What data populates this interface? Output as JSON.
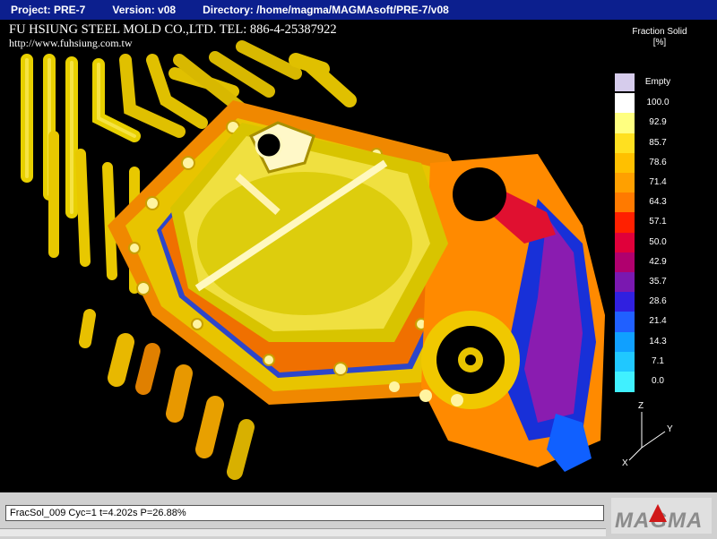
{
  "titlebar": {
    "project": "Project: PRE-7",
    "version": "Version: v08",
    "directory": "Directory: /home/magma/MAGMAsoft/PRE-7/v08"
  },
  "overlay": {
    "company_line": "FU HSIUNG STEEL MOLD CO.,LTD.  TEL:  886-4-25387922",
    "url": "http://www.fuhsiung.com.tw"
  },
  "legend": {
    "title_line1": "Fraction Solid",
    "title_line2": "[%]",
    "entries": [
      {
        "label": "Empty",
        "color": "#d6ccec"
      },
      {
        "label": "100.0",
        "color": "#ffffff"
      },
      {
        "label": "92.9",
        "color": "#ffff80"
      },
      {
        "label": "85.7",
        "color": "#ffe020"
      },
      {
        "label": "78.6",
        "color": "#ffc000"
      },
      {
        "label": "71.4",
        "color": "#ffa000"
      },
      {
        "label": "64.3",
        "color": "#ff7a00"
      },
      {
        "label": "57.1",
        "color": "#ff2000"
      },
      {
        "label": "50.0",
        "color": "#e0003a"
      },
      {
        "label": "42.9",
        "color": "#b0006e"
      },
      {
        "label": "35.7",
        "color": "#7a18b0"
      },
      {
        "label": "28.6",
        "color": "#3020e0"
      },
      {
        "label": "21.4",
        "color": "#2060ff"
      },
      {
        "label": "14.3",
        "color": "#10a0ff"
      },
      {
        "label": "7.1",
        "color": "#20c8ff"
      },
      {
        "label": "0.0",
        "color": "#40f0ff"
      }
    ]
  },
  "axes": {
    "z": "Z",
    "y": "Y",
    "x": "X"
  },
  "status": {
    "text": "FracSol_009 Cyc=1 t=4.202s P=26.88%"
  },
  "logo": {
    "text": "MAGMA",
    "accent": "#d01818"
  }
}
